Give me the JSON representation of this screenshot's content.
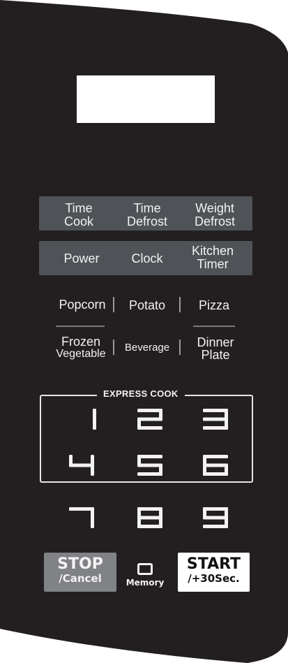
{
  "panel": {
    "color": "#231f20",
    "display_color": "#ffffff",
    "bar_color": "#4f5256"
  },
  "row1": [
    {
      "line1": "Time",
      "line2": "Cook"
    },
    {
      "line1": "Time",
      "line2": "Defrost"
    },
    {
      "line1": "Weight",
      "line2": "Defrost"
    }
  ],
  "row2": [
    {
      "line1": "Power"
    },
    {
      "line1": "Clock"
    },
    {
      "line1": "Kitchen",
      "line2": "Timer"
    }
  ],
  "food_row1": [
    "Popcorn",
    "Potato",
    "Pizza"
  ],
  "food_row2": {
    "frozen": {
      "line1": "Frozen",
      "line2": "Vegetable"
    },
    "beverage": "Beverage",
    "dinner": {
      "line1": "Dinner",
      "line2": "Plate"
    }
  },
  "express_cook_label": "EXPRESS COOK",
  "digits": [
    "1",
    "2",
    "3",
    "4",
    "5",
    "6",
    "7",
    "8",
    "9"
  ],
  "stop": {
    "line1": "STOP",
    "line2": "/Cancel",
    "color": "#808285"
  },
  "memory": {
    "label": "Memory",
    "digit": "0"
  },
  "start": {
    "line1": "START",
    "line2": "/+30Sec.",
    "color": "#ffffff"
  }
}
